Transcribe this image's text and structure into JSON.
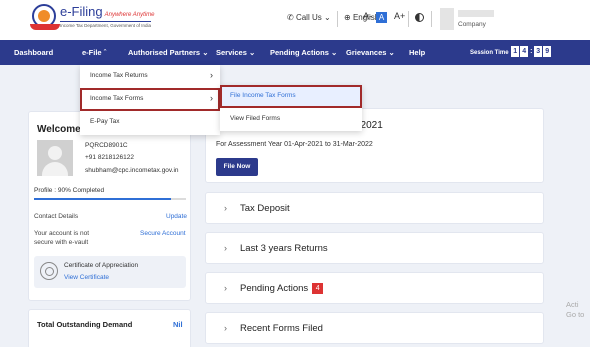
{
  "header": {
    "logo_title": "e-Filing",
    "logo_tagline": "Anywhere Anytime",
    "logo_subtitle": "Income Tax Department, Government of India",
    "call_us": "Call Us",
    "language": "English",
    "font_small": "A-",
    "font_default": "A",
    "font_large": "A+",
    "company": "Company"
  },
  "nav": {
    "items": [
      "Dashboard",
      "e-File",
      "Authorised Partners",
      "Services",
      "Pending Actions",
      "Grievances",
      "Help"
    ],
    "session_label": "Session Time",
    "session_digits": [
      "1",
      "4",
      ":",
      "3",
      "9"
    ]
  },
  "efile_menu": {
    "items": [
      "Income Tax Returns",
      "Income Tax Forms",
      "E-Pay Tax"
    ]
  },
  "forms_submenu": {
    "items": [
      "File Income Tax Forms",
      "View Filed Forms"
    ]
  },
  "profile": {
    "welcome": "Welcome I",
    "pan": "PQRCD8901C",
    "phone": "+91 8218126122",
    "email": "shubham@cpc.incometax.gov.in",
    "profile_completion": "Profile : 90% Completed",
    "progress_percent": 90,
    "contact_label": "Contact Details",
    "update_link": "Update",
    "account_status": "Your account is not secure with e-vault",
    "secure_link": "Secure Account",
    "certificate_title": "Certificate of Appreciation",
    "certificate_link": "View Certificate"
  },
  "demand": {
    "title": "Total Outstanding Demand",
    "value": "Nil"
  },
  "file_card": {
    "heading_fragment": "Mar-2021",
    "assessment_year": "For Assessment Year 01-Apr-2021 to 31-Mar-2022",
    "file_now": "File Now"
  },
  "accordions": [
    {
      "label": "Tax Deposit"
    },
    {
      "label": "Last 3 years Returns"
    },
    {
      "label": "Pending Actions",
      "badge": "4"
    },
    {
      "label": "Recent Forms Filed"
    }
  ],
  "watermark": {
    "line1": "Acti",
    "line2": "Go to"
  },
  "colors": {
    "nav_bg": "#2c3a8c",
    "link": "#2f6fd6",
    "highlight_border": "#a12a2a",
    "badge": "#dd3333"
  }
}
